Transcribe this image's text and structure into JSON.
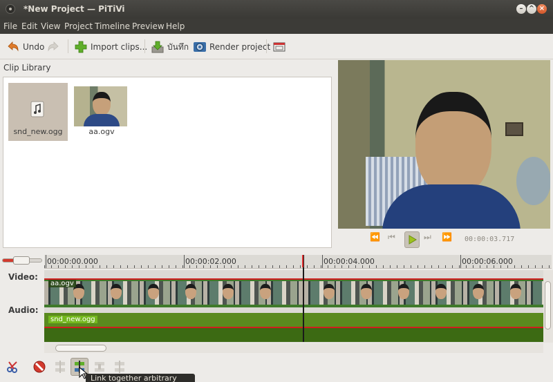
{
  "window": {
    "title": "*New Project — PiTiVi"
  },
  "menubar": {
    "items": [
      "File",
      "Edit",
      "View",
      "Project",
      "Timeline",
      "Preview",
      "Help"
    ]
  },
  "toolbar": {
    "undo_label": "Undo",
    "import_label": "Import clips...",
    "save_label": "บันทึก",
    "render_label": "Render project"
  },
  "library": {
    "title": "Clip Library",
    "clips": [
      {
        "name": "snd_new.ogg",
        "type": "audio",
        "selected": true
      },
      {
        "name": "aa.ogv",
        "type": "video",
        "selected": false
      }
    ]
  },
  "viewer": {
    "timecode": "00:00:03.717"
  },
  "timeline": {
    "ruler_marks": [
      "00:00:00.000",
      "00:00:02.000",
      "00:00:04.000",
      "00:00:06.000"
    ],
    "video_label": "Video:",
    "audio_label": "Audio:",
    "video_clip_name": "aa.ogv",
    "audio_clip_name": "snd_new.ogg"
  },
  "tooltip": {
    "text": "Link together arbitrary clips"
  },
  "colors": {
    "titlebar": "#3c3b37",
    "accent": "#d01d1d",
    "clip_green": "#5a8a1e"
  }
}
